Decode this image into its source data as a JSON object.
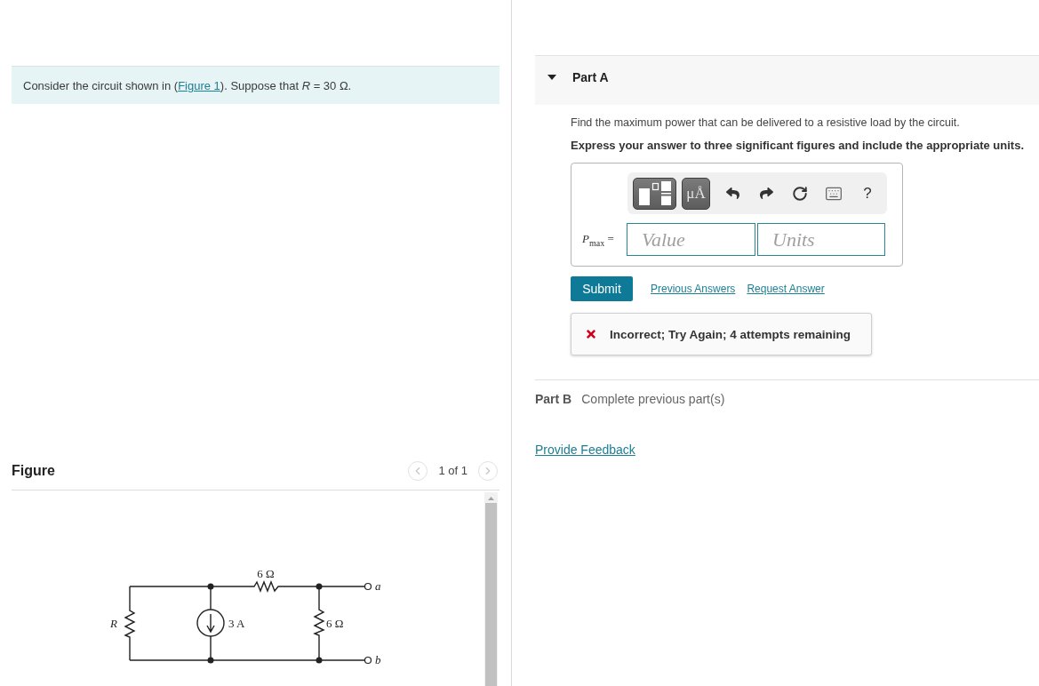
{
  "problem": {
    "intro_before": "Consider the circuit shown in (",
    "figure_link": "Figure 1",
    "intro_after": "). Suppose that *R* = 30 Ω."
  },
  "figure": {
    "title": "Figure",
    "pager": {
      "label": "1 of 1",
      "prev_disabled": true,
      "next_disabled": true
    },
    "circuit": {
      "resistor_r": "R",
      "source": "3 A",
      "series_resistor": "6 Ω",
      "shunt_resistor": "6 Ω",
      "terminal_a": "a",
      "terminal_b": "b"
    }
  },
  "part_a": {
    "title": "Part A",
    "expanded": true,
    "question": "Find the maximum power that can be delivered to a resistive load by the circuit.",
    "instruction": "Express your answer to three significant figures and include the appropriate units.",
    "toolbar": {
      "units_button": "μÅ",
      "help": "?"
    },
    "answer": {
      "label": "*P*$_{max}$ =",
      "value_placeholder": "Value",
      "units_placeholder": "Units"
    },
    "submit": "Submit",
    "links": [
      "Previous Answers",
      "Request Answer"
    ],
    "feedback": {
      "kind": "incorrect",
      "message": "Incorrect; Try Again; 4 attempts remaining"
    }
  },
  "part_b": {
    "title": "Part B",
    "status": "Complete previous part(s)"
  },
  "provide_feedback": "Provide Feedback"
}
